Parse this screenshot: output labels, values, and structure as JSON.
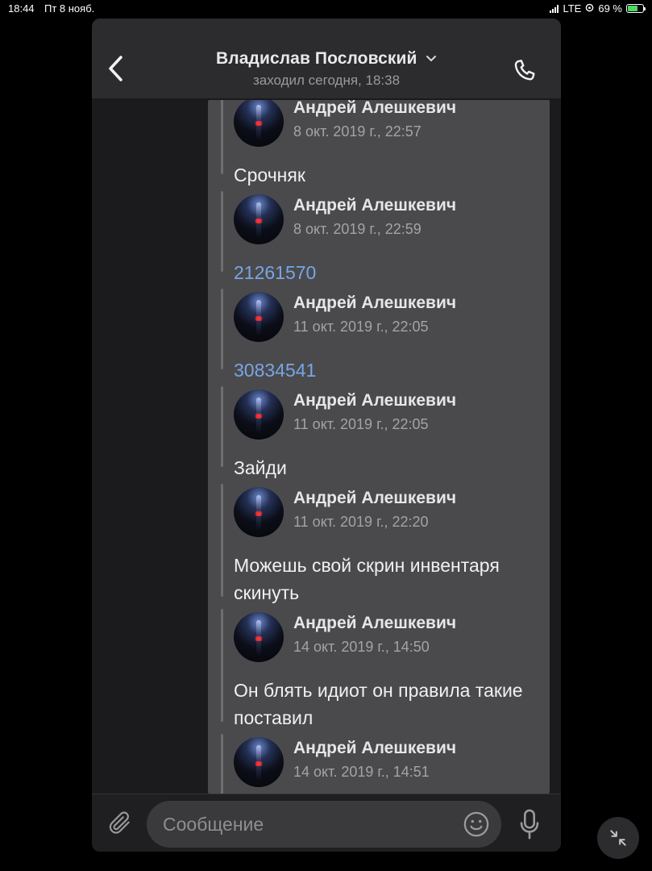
{
  "status_bar": {
    "time": "18:44",
    "date": "Пт 8 нояб.",
    "network": "LTE",
    "battery": "69 %",
    "battery_level": 0.69
  },
  "header": {
    "title": "Владислав Пословский",
    "subtitle": "заходил сегодня, 18:38"
  },
  "messages": [
    {
      "sender": "Андрей Алешкевич",
      "date": "8 окт. 2019 г., 22:57",
      "text": "Срочняк",
      "is_link": false
    },
    {
      "sender": "Андрей Алешкевич",
      "date": "8 окт. 2019 г., 22:59",
      "text": "21261570",
      "is_link": true
    },
    {
      "sender": "Андрей Алешкевич",
      "date": "11 окт. 2019 г., 22:05",
      "text": "30834541",
      "is_link": true
    },
    {
      "sender": "Андрей Алешкевич",
      "date": "11 окт. 2019 г., 22:05",
      "text": "Зайди",
      "is_link": false
    },
    {
      "sender": "Андрей Алешкевич",
      "date": "11 окт. 2019 г., 22:20",
      "text": "Можешь свой скрин инвентаря скинуть",
      "is_link": false
    },
    {
      "sender": "Андрей Алешкевич",
      "date": "14 окт. 2019 г., 14:50",
      "text": "Он блять идиот он правила такие поставил",
      "is_link": false
    },
    {
      "sender": "Андрей Алешкевич",
      "date": "14 окт. 2019 г., 14:51",
      "text": "",
      "is_link": false
    }
  ],
  "composer": {
    "placeholder": "Сообщение"
  },
  "colors": {
    "link": "#78a5e6",
    "bubble": "#4a4a4c",
    "background": "#1b1b1d",
    "battery_fill": "#4cd964"
  },
  "icons": [
    "back-chevron-icon",
    "chevron-down-icon",
    "phone-icon",
    "paperclip-icon",
    "emoji-icon",
    "microphone-icon",
    "scroll-down-chevron-icon",
    "minimize-arrows-icon"
  ]
}
